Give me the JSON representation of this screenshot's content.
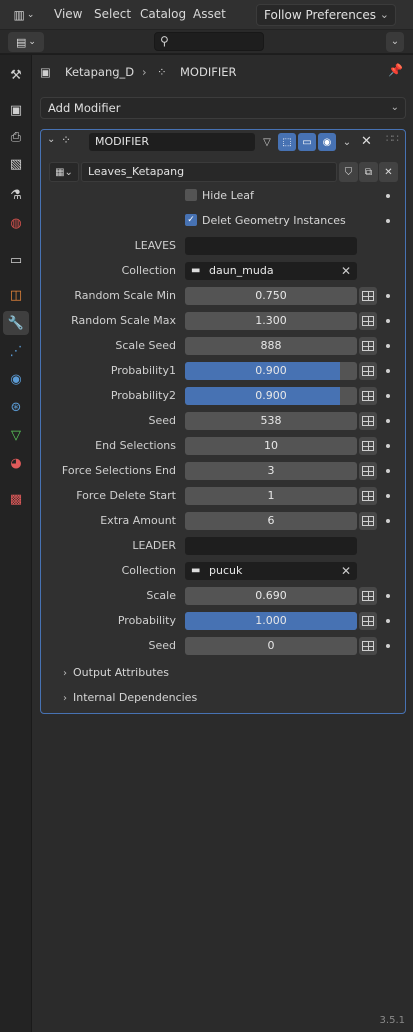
{
  "topbar": {
    "editor_icon": "graph-icon",
    "menu": [
      "View",
      "Select",
      "Catalog",
      "Asset"
    ],
    "preferences_dropdown": "Follow Preferences"
  },
  "secondary_bar": {
    "search_placeholder": ""
  },
  "breadcrumb": {
    "object": "Ketapang_D",
    "modifier": "MODIFIER"
  },
  "add_modifier_label": "Add Modifier",
  "modifier": {
    "name": "MODIFIER",
    "node_tree": "Leaves_Ketapang",
    "inputs": [
      {
        "type": "checkbox",
        "label": "Hide Leaf",
        "checked": false
      },
      {
        "type": "checkbox",
        "label": "Delet Geometry Instances",
        "checked": true
      },
      {
        "type": "object",
        "label": "LEAVES",
        "value": ""
      },
      {
        "type": "collection",
        "label": "Collection",
        "value": "daun_muda"
      },
      {
        "type": "number",
        "label": "Random Scale Min",
        "value": "0.750"
      },
      {
        "type": "number",
        "label": "Random Scale Max",
        "value": "1.300"
      },
      {
        "type": "number",
        "label": "Scale Seed",
        "value": "888"
      },
      {
        "type": "factor",
        "label": "Probability1",
        "value": "0.900",
        "fraction": 0.9
      },
      {
        "type": "factor",
        "label": "Probability2",
        "value": "0.900",
        "fraction": 0.9
      },
      {
        "type": "number",
        "label": "Seed",
        "value": "538"
      },
      {
        "type": "number",
        "label": "End Selections",
        "value": "10"
      },
      {
        "type": "number",
        "label": "Force Selections End",
        "value": "3"
      },
      {
        "type": "number",
        "label": "Force Delete Start",
        "value": "1"
      },
      {
        "type": "number",
        "label": "Extra Amount",
        "value": "6"
      },
      {
        "type": "object",
        "label": "LEADER",
        "value": ""
      },
      {
        "type": "collection",
        "label": "Collection",
        "value": "pucuk"
      },
      {
        "type": "number",
        "label": "Scale",
        "value": "0.690"
      },
      {
        "type": "factor",
        "label": "Probability",
        "value": "1.000",
        "fraction": 1.0
      },
      {
        "type": "number",
        "label": "Seed",
        "value": "0"
      }
    ],
    "subpanels": [
      "Output Attributes",
      "Internal Dependencies"
    ]
  },
  "version": "3.5.1",
  "colors": {
    "accent": "#4772b3",
    "panel": "#2b2b2b",
    "field": "#545454"
  }
}
